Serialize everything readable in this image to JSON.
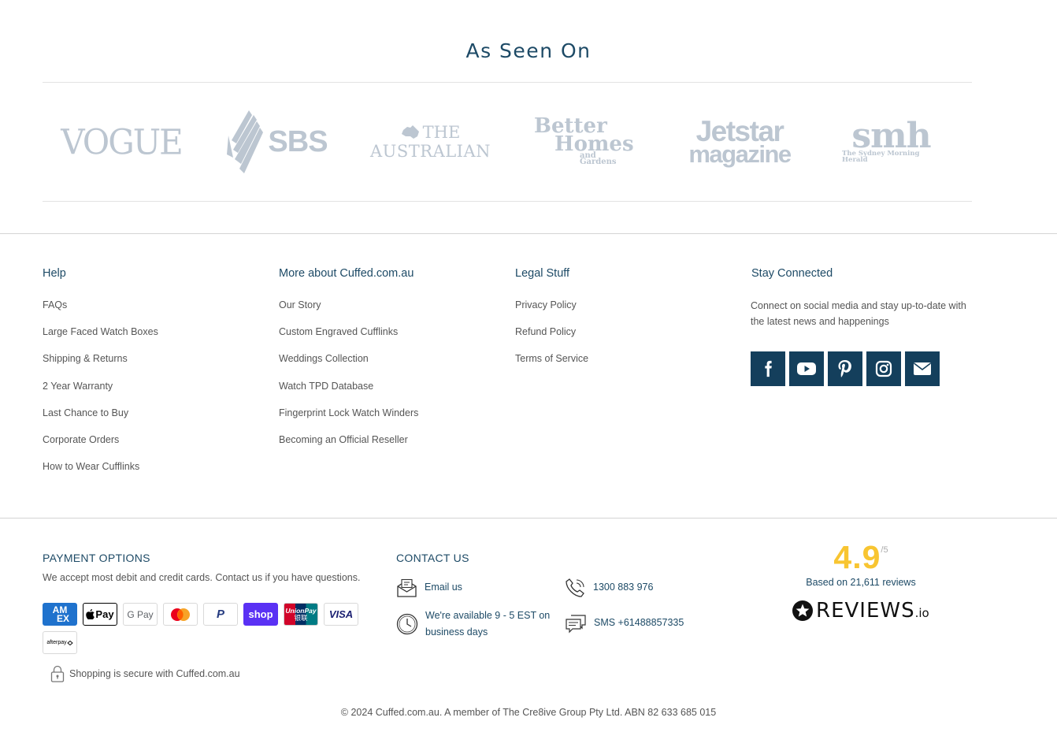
{
  "as_seen_on": {
    "title": "As Seen On",
    "logos": [
      {
        "name": "Vogue",
        "text": "VOGUE"
      },
      {
        "name": "SBS",
        "text": "SBS"
      },
      {
        "name": "The Australian",
        "line1": "THE",
        "line2": "AUSTRALIAN"
      },
      {
        "name": "Better Homes and Gardens",
        "line1": "Better",
        "line2": "Homes",
        "line3": "and Gardens"
      },
      {
        "name": "Jetstar magazine",
        "line1": "Jetstar",
        "line2": "magazine"
      },
      {
        "name": "The Sydney Morning Herald",
        "line1": "smh",
        "line2": "The Sydney Morning Herald"
      }
    ]
  },
  "footer": {
    "help": {
      "title": "Help",
      "items": [
        "FAQs",
        "Large Faced Watch Boxes",
        "Shipping & Returns",
        "2 Year Warranty",
        "Last Chance to Buy",
        "Corporate Orders",
        "How to Wear Cufflinks"
      ]
    },
    "more": {
      "title": "More about Cuffed.com.au",
      "items": [
        "Our Story",
        "Custom Engraved Cufflinks",
        "Weddings Collection",
        "Watch TPD Database",
        "Fingerprint Lock Watch Winders",
        "Becoming an Official Reseller"
      ]
    },
    "legal": {
      "title": "Legal Stuff",
      "items": [
        "Privacy Policy",
        "Refund Policy",
        "Terms of Service"
      ]
    },
    "stay": {
      "title": "Stay Connected",
      "text": "Connect on social media and stay up-to-date with the latest news and happenings",
      "socials": [
        "facebook-icon",
        "youtube-icon",
        "pinterest-icon",
        "instagram-icon",
        "email-icon"
      ]
    }
  },
  "payment": {
    "title": "PAYMENT OPTIONS",
    "text": "We accept most debit and credit cards. Contact us if you have questions.",
    "cards": [
      {
        "name": "amex",
        "label_top": "AM",
        "label_bottom": "EX"
      },
      {
        "name": "apple-pay",
        "label": "Pay"
      },
      {
        "name": "google-pay",
        "label": "G Pay"
      },
      {
        "name": "mastercard"
      },
      {
        "name": "paypal",
        "label": "P"
      },
      {
        "name": "shop-pay",
        "label": "shop"
      },
      {
        "name": "unionpay",
        "label_top": "UnionPay",
        "label_bottom": "银联"
      },
      {
        "name": "visa",
        "label": "VISA"
      },
      {
        "name": "afterpay",
        "label": "afterpay"
      }
    ],
    "secure_text": "Shopping is secure with Cuffed.com.au"
  },
  "contact": {
    "title": "CONTACT US",
    "email": "Email us",
    "phone": "1300 883 976",
    "hours": "We're available 9 - 5 EST on business days",
    "sms": "SMS +61488857335"
  },
  "reviews": {
    "score": "4.9",
    "out_of": "/5",
    "based_on": "Based on 21,611 reviews",
    "brand": "REVIEWS",
    "brand_suffix": ".io",
    "score_color": "#f8c531"
  },
  "copyright": "© 2024 Cuffed.com.au. A member of The Cre8ive Group Pty Ltd. ABN 82 633 685 015",
  "colors": {
    "accent": "#1d4a66",
    "social_bg": "#143f5c",
    "logo_gray": "#bcc6d1"
  }
}
